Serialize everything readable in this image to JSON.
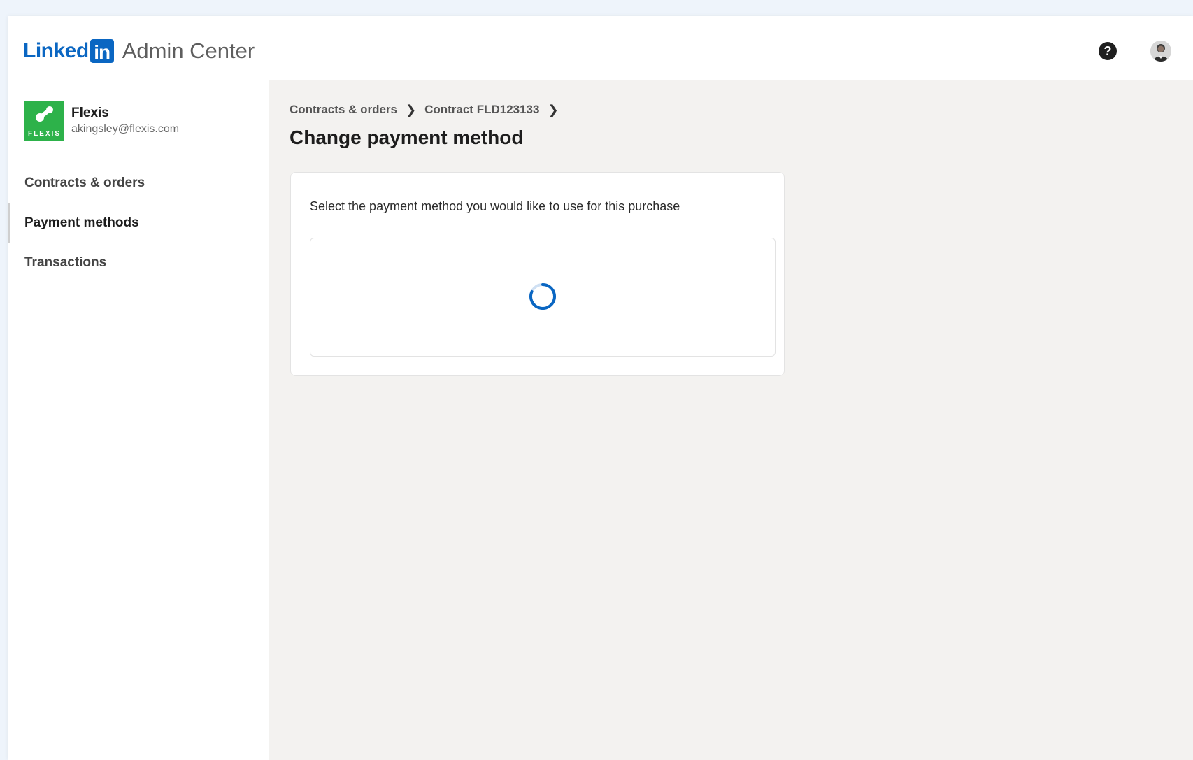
{
  "header": {
    "brand_word": "Linked",
    "brand_box": "in",
    "product": "Admin Center",
    "help_glyph": "?",
    "icons": [
      "help-icon",
      "avatar"
    ]
  },
  "sidebar": {
    "org": {
      "name": "Flexis",
      "email": "akingsley@flexis.com",
      "logo_text": "FLEXIS",
      "logo_color": "#2db24a"
    },
    "items": [
      {
        "label": "Contracts & orders",
        "active": false
      },
      {
        "label": "Payment methods",
        "active": true
      },
      {
        "label": "Transactions",
        "active": false
      }
    ]
  },
  "main": {
    "breadcrumb": [
      {
        "label": "Contracts & orders"
      },
      {
        "label": "Contract FLD123133"
      }
    ],
    "breadcrumb_sep": "❯",
    "title": "Change payment method",
    "card": {
      "instruction": "Select the payment method you would like to use for this purchase",
      "loading": true
    }
  },
  "colors": {
    "brand_blue": "#0a66c2",
    "spinner_blue": "#0a66c2",
    "page_bg": "#f3f2f0"
  }
}
